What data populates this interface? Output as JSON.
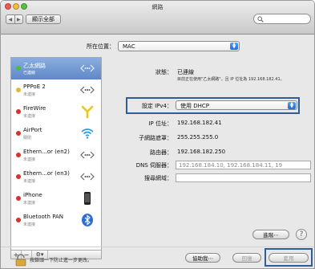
{
  "window": {
    "title": "網路"
  },
  "toolbar": {
    "back_glyph": "◀",
    "forward_glyph": "▶",
    "show_all_label": "顯示全部",
    "search_placeholder": ""
  },
  "location": {
    "label": "所在位置：",
    "value": "MAC"
  },
  "services": [
    {
      "name": "乙太網路",
      "status": "已連線",
      "status_color": "green",
      "icon": "ethernet-icon",
      "selected": true
    },
    {
      "name": "PPPoE 2",
      "status": "未連接",
      "status_color": "yellow",
      "icon": "ethernet-icon",
      "selected": false
    },
    {
      "name": "FireWire",
      "status": "未連接",
      "status_color": "red",
      "icon": "firewire-icon",
      "selected": false
    },
    {
      "name": "AirPort",
      "status": "關閉",
      "status_color": "red",
      "icon": "wifi-icon",
      "selected": false
    },
    {
      "name": "Ethern...or (en2)",
      "status": "未連接",
      "status_color": "red",
      "icon": "ethernet-icon",
      "selected": false
    },
    {
      "name": "Ethern...or (en3)",
      "status": "未連接",
      "status_color": "red",
      "icon": "ethernet-icon",
      "selected": false
    },
    {
      "name": "iPhone",
      "status": "未連接",
      "status_color": "red",
      "icon": "iphone-icon",
      "selected": false
    },
    {
      "name": "Bluetooth PAN",
      "status": "未連接",
      "status_color": "red",
      "icon": "bluetooth-icon",
      "selected": false
    }
  ],
  "sidebar_buttons": {
    "add": "+",
    "remove": "−",
    "gear": "⚙▾"
  },
  "details": {
    "status_label": "狀態：",
    "status_value": "已連線",
    "status_desc": "目前正在使用\"乙太網路\"，且 IP 位址為 192.168.182.41。",
    "configure_label": "設定 IPv4：",
    "configure_value": "使用 DHCP",
    "ip_label": "IP 位址：",
    "ip_value": "192.168.182.41",
    "subnet_label": "子網路遮罩：",
    "subnet_value": "255.255.255.0",
    "router_label": "路由器：",
    "router_value": "192.168.182.250",
    "dns_label": "DNS 伺服器：",
    "dns_value": "192.168.184.10, 192.168.184.11, 19",
    "search_domains_label": "搜尋網域：",
    "search_domains_value": ""
  },
  "buttons": {
    "advanced": "進階⋯",
    "help": "?",
    "assist": "協助我⋯",
    "revert": "回復",
    "apply": "套用"
  },
  "lock": {
    "text": "按鎖頭一下防止進一步更改。"
  },
  "colors": {
    "selection": "#6f94cf",
    "highlight_box": "#2e5e98",
    "status_connected": "#4bbd3b",
    "status_warning": "#e6b73a",
    "status_off": "#d8322e"
  }
}
